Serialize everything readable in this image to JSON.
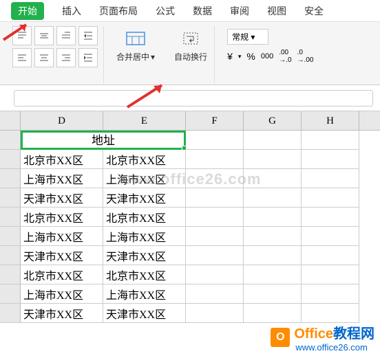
{
  "tabs": [
    "开始",
    "插入",
    "页面布局",
    "公式",
    "数据",
    "审阅",
    "视图",
    "安全"
  ],
  "ribbon": {
    "merge_label": "合并居中",
    "wrap_label": "自动换行",
    "format_label": "常规",
    "currency": "¥",
    "percent": "%",
    "thousand": "000",
    "dec_inc": ".00",
    "dec_dec": ".0"
  },
  "columns": [
    "D",
    "E",
    "F",
    "G",
    "H"
  ],
  "merged_header": "地址",
  "chart_data": {
    "type": "table",
    "columns": [
      "D",
      "E"
    ],
    "rows": [
      [
        "北京市XX区",
        "北京市XX区"
      ],
      [
        "上海市XX区",
        "上海市XX区"
      ],
      [
        "天津市XX区",
        "天津市XX区"
      ],
      [
        "北京市XX区",
        "北京市XX区"
      ],
      [
        "上海市XX区",
        "上海市XX区"
      ],
      [
        "天津市XX区",
        "天津市XX区"
      ],
      [
        "北京市XX区",
        "北京市XX区"
      ],
      [
        "上海市XX区",
        "上海市XX区"
      ],
      [
        "天津市XX区",
        "天津市XX区"
      ]
    ]
  },
  "watermark": "www.office26.com",
  "logo": {
    "text1": "Office",
    "text2": "教程网",
    "url": "www.office26.com"
  }
}
